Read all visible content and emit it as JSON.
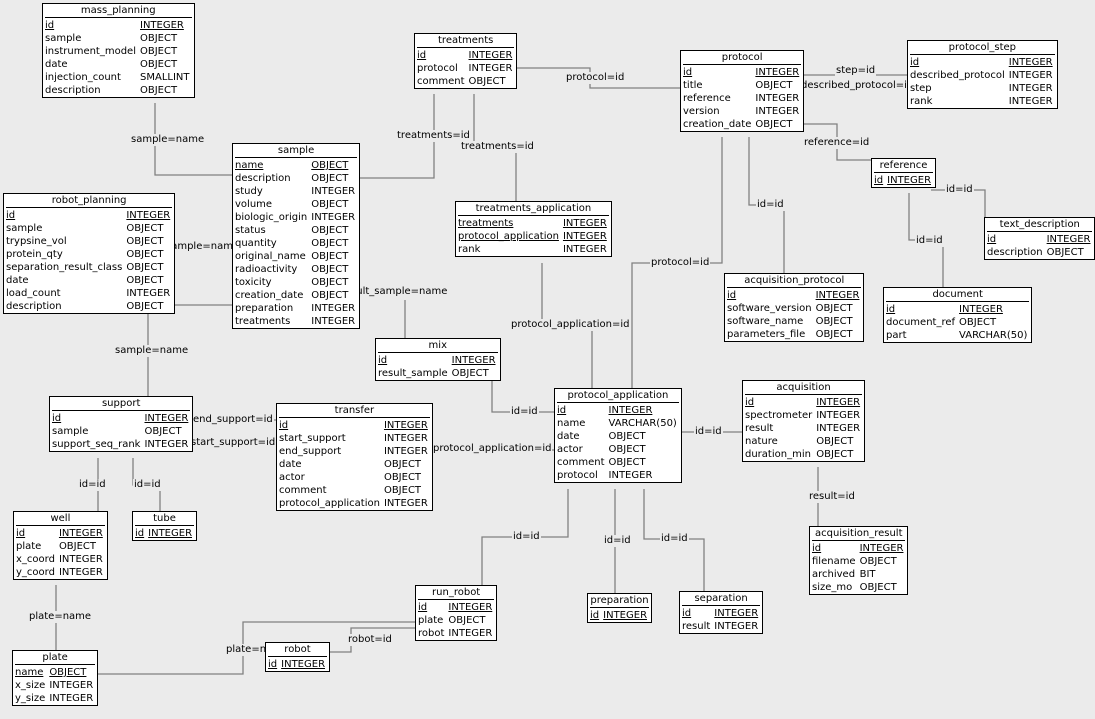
{
  "diagram": {
    "line_color": "#808080",
    "entities": [
      {
        "id": "mass_planning",
        "title": "mass_planning",
        "columns": [
          [
            "id",
            "INTEGER",
            true
          ],
          [
            "sample",
            "OBJECT"
          ],
          [
            "instrument_model",
            "OBJECT"
          ],
          [
            "date",
            "OBJECT"
          ],
          [
            "injection_count",
            "SMALLINT"
          ],
          [
            "description",
            "OBJECT"
          ]
        ]
      },
      {
        "id": "treatments",
        "title": "treatments",
        "columns": [
          [
            "id",
            "INTEGER",
            true
          ],
          [
            "protocol",
            "INTEGER"
          ],
          [
            "comment",
            "OBJECT"
          ]
        ]
      },
      {
        "id": "protocol",
        "title": "protocol",
        "columns": [
          [
            "id",
            "INTEGER",
            true
          ],
          [
            "title",
            "OBJECT"
          ],
          [
            "reference",
            "INTEGER"
          ],
          [
            "version",
            "INTEGER"
          ],
          [
            "creation_date",
            "OBJECT"
          ]
        ]
      },
      {
        "id": "protocol_step",
        "title": "protocol_step",
        "columns": [
          [
            "id",
            "INTEGER",
            true
          ],
          [
            "described_protocol",
            "INTEGER"
          ],
          [
            "step",
            "INTEGER"
          ],
          [
            "rank",
            "INTEGER"
          ]
        ]
      },
      {
        "id": "sample",
        "title": "sample",
        "columns": [
          [
            "name",
            "OBJECT",
            true
          ],
          [
            "description",
            "OBJECT"
          ],
          [
            "study",
            "INTEGER"
          ],
          [
            "volume",
            "OBJECT"
          ],
          [
            "biologic_origin",
            "INTEGER"
          ],
          [
            "status",
            "OBJECT"
          ],
          [
            "quantity",
            "OBJECT"
          ],
          [
            "original_name",
            "OBJECT"
          ],
          [
            "radioactivity",
            "OBJECT"
          ],
          [
            "toxicity",
            "OBJECT"
          ],
          [
            "creation_date",
            "OBJECT"
          ],
          [
            "preparation",
            "INTEGER"
          ],
          [
            "treatments",
            "INTEGER"
          ]
        ]
      },
      {
        "id": "robot_planning",
        "title": "robot_planning",
        "columns": [
          [
            "id",
            "INTEGER",
            true
          ],
          [
            "sample",
            "OBJECT"
          ],
          [
            "trypsine_vol",
            "OBJECT"
          ],
          [
            "protein_qty",
            "OBJECT"
          ],
          [
            "separation_result_class",
            "OBJECT"
          ],
          [
            "date",
            "OBJECT"
          ],
          [
            "load_count",
            "INTEGER"
          ],
          [
            "description",
            "OBJECT"
          ]
        ]
      },
      {
        "id": "treatments_application",
        "title": "treatments_application",
        "columns": [
          [
            "treatments",
            "INTEGER",
            true
          ],
          [
            "protocol_application",
            "INTEGER",
            true
          ],
          [
            "rank",
            "INTEGER"
          ]
        ]
      },
      {
        "id": "reference",
        "title": "reference",
        "columns": [
          [
            "id",
            "INTEGER",
            true
          ]
        ]
      },
      {
        "id": "text_description",
        "title": "text_description",
        "columns": [
          [
            "id",
            "INTEGER",
            true
          ],
          [
            "description",
            "OBJECT"
          ]
        ]
      },
      {
        "id": "acquisition_protocol",
        "title": "acquisition_protocol",
        "columns": [
          [
            "id",
            "INTEGER",
            true
          ],
          [
            "software_version",
            "OBJECT"
          ],
          [
            "software_name",
            "OBJECT"
          ],
          [
            "parameters_file",
            "OBJECT"
          ]
        ]
      },
      {
        "id": "document",
        "title": "document",
        "columns": [
          [
            "id",
            "INTEGER",
            true
          ],
          [
            "document_ref",
            "OBJECT"
          ],
          [
            "part",
            "VARCHAR(50)"
          ]
        ]
      },
      {
        "id": "mix",
        "title": "mix",
        "columns": [
          [
            "id",
            "INTEGER",
            true
          ],
          [
            "result_sample",
            "OBJECT"
          ]
        ]
      },
      {
        "id": "support",
        "title": "support",
        "columns": [
          [
            "id",
            "INTEGER",
            true
          ],
          [
            "sample",
            "OBJECT"
          ],
          [
            "support_seq_rank",
            "INTEGER"
          ]
        ]
      },
      {
        "id": "transfer",
        "title": "transfer",
        "columns": [
          [
            "id",
            "INTEGER",
            true
          ],
          [
            "start_support",
            "INTEGER"
          ],
          [
            "end_support",
            "INTEGER"
          ],
          [
            "date",
            "OBJECT"
          ],
          [
            "actor",
            "OBJECT"
          ],
          [
            "comment",
            "OBJECT"
          ],
          [
            "protocol_application",
            "INTEGER"
          ]
        ]
      },
      {
        "id": "protocol_application",
        "title": "protocol_application",
        "columns": [
          [
            "id",
            "INTEGER",
            true
          ],
          [
            "name",
            "VARCHAR(50)"
          ],
          [
            "date",
            "OBJECT"
          ],
          [
            "actor",
            "OBJECT"
          ],
          [
            "comment",
            "OBJECT"
          ],
          [
            "protocol",
            "INTEGER"
          ]
        ]
      },
      {
        "id": "acquisition",
        "title": "acquisition",
        "columns": [
          [
            "id",
            "INTEGER",
            true
          ],
          [
            "spectrometer",
            "INTEGER"
          ],
          [
            "result",
            "INTEGER"
          ],
          [
            "nature",
            "OBJECT"
          ],
          [
            "duration_min",
            "OBJECT"
          ]
        ]
      },
      {
        "id": "acquisition_result",
        "title": "acquisition_result",
        "columns": [
          [
            "id",
            "INTEGER",
            true
          ],
          [
            "filename",
            "OBJECT"
          ],
          [
            "archived",
            "BIT"
          ],
          [
            "size_mo",
            "OBJECT"
          ]
        ]
      },
      {
        "id": "well",
        "title": "well",
        "columns": [
          [
            "id",
            "INTEGER",
            true
          ],
          [
            "plate",
            "OBJECT"
          ],
          [
            "x_coord",
            "INTEGER"
          ],
          [
            "y_coord",
            "INTEGER"
          ]
        ]
      },
      {
        "id": "tube",
        "title": "tube",
        "columns": [
          [
            "id",
            "INTEGER",
            true
          ]
        ]
      },
      {
        "id": "run_robot",
        "title": "run_robot",
        "columns": [
          [
            "id",
            "INTEGER",
            true
          ],
          [
            "plate",
            "OBJECT"
          ],
          [
            "robot",
            "INTEGER"
          ]
        ]
      },
      {
        "id": "robot",
        "title": "robot",
        "columns": [
          [
            "id",
            "INTEGER",
            true
          ]
        ]
      },
      {
        "id": "preparation",
        "title": "preparation",
        "columns": [
          [
            "id",
            "INTEGER",
            true
          ]
        ]
      },
      {
        "id": "separation",
        "title": "separation",
        "columns": [
          [
            "id",
            "INTEGER",
            true
          ],
          [
            "result",
            "INTEGER"
          ]
        ]
      },
      {
        "id": "plate",
        "title": "plate",
        "columns": [
          [
            "name",
            "OBJECT",
            true
          ],
          [
            "x_size",
            "INTEGER"
          ],
          [
            "y_size",
            "INTEGER"
          ]
        ]
      }
    ],
    "relations": [
      {
        "id": "r1",
        "label": "sample=name",
        "from": "mass_planning",
        "to": "sample"
      },
      {
        "id": "r2",
        "label": "treatments=id",
        "from": "sample",
        "to": "treatments"
      },
      {
        "id": "r3",
        "label": "treatments=id",
        "from": "treatments_application",
        "to": "treatments"
      },
      {
        "id": "r4",
        "label": "protocol=id",
        "from": "treatments",
        "to": "protocol"
      },
      {
        "id": "r5",
        "label": "step=id",
        "from": "protocol_step",
        "to": "protocol"
      },
      {
        "id": "r6",
        "label": "described_protocol=id",
        "from": "protocol_step",
        "to": "protocol"
      },
      {
        "id": "r7",
        "label": "reference=id",
        "from": "protocol",
        "to": "reference"
      },
      {
        "id": "r8",
        "label": "id=id",
        "from": "acquisition_protocol",
        "to": "protocol"
      },
      {
        "id": "r9",
        "label": "protocol=id",
        "from": "protocol_application",
        "to": "protocol"
      },
      {
        "id": "r10",
        "label": "id=id",
        "from": "reference",
        "to": "document"
      },
      {
        "id": "r11",
        "label": "id=id",
        "from": "text_description",
        "to": "reference"
      },
      {
        "id": "r12",
        "label": "protocol_application=id",
        "from": "treatments_application",
        "to": "protocol_application"
      },
      {
        "id": "r13",
        "label": "sample=name",
        "from": "robot_planning",
        "to": "sample"
      },
      {
        "id": "r14",
        "label": "sample=name",
        "from": "support",
        "to": "sample"
      },
      {
        "id": "r15",
        "label": "result_sample=name",
        "from": "mix",
        "to": "sample"
      },
      {
        "id": "r16",
        "label": "id=id",
        "from": "mix",
        "to": "protocol_application"
      },
      {
        "id": "r17",
        "label": "end_support=id",
        "from": "transfer",
        "to": "support"
      },
      {
        "id": "r18",
        "label": "start_support=id",
        "from": "transfer",
        "to": "support"
      },
      {
        "id": "r19",
        "label": "protocol_application=id",
        "from": "transfer",
        "to": "protocol_application"
      },
      {
        "id": "r20",
        "label": "id=id",
        "from": "well",
        "to": "support"
      },
      {
        "id": "r21",
        "label": "id=id",
        "from": "support",
        "to": "tube"
      },
      {
        "id": "r22",
        "label": "plate=name",
        "from": "well",
        "to": "plate"
      },
      {
        "id": "r23",
        "label": "plate=name",
        "from": "run_robot",
        "to": "plate"
      },
      {
        "id": "r24",
        "label": "robot=id",
        "from": "run_robot",
        "to": "robot"
      },
      {
        "id": "r25",
        "label": "id=id",
        "from": "run_robot",
        "to": "protocol_application"
      },
      {
        "id": "r26",
        "label": "id=id",
        "from": "preparation",
        "to": "protocol_application"
      },
      {
        "id": "r27",
        "label": "id=id",
        "from": "separation",
        "to": "protocol_application"
      },
      {
        "id": "r28",
        "label": "id=id",
        "from": "acquisition",
        "to": "protocol_application"
      },
      {
        "id": "r29",
        "label": "result=id",
        "from": "acquisition",
        "to": "acquisition_result"
      }
    ]
  }
}
